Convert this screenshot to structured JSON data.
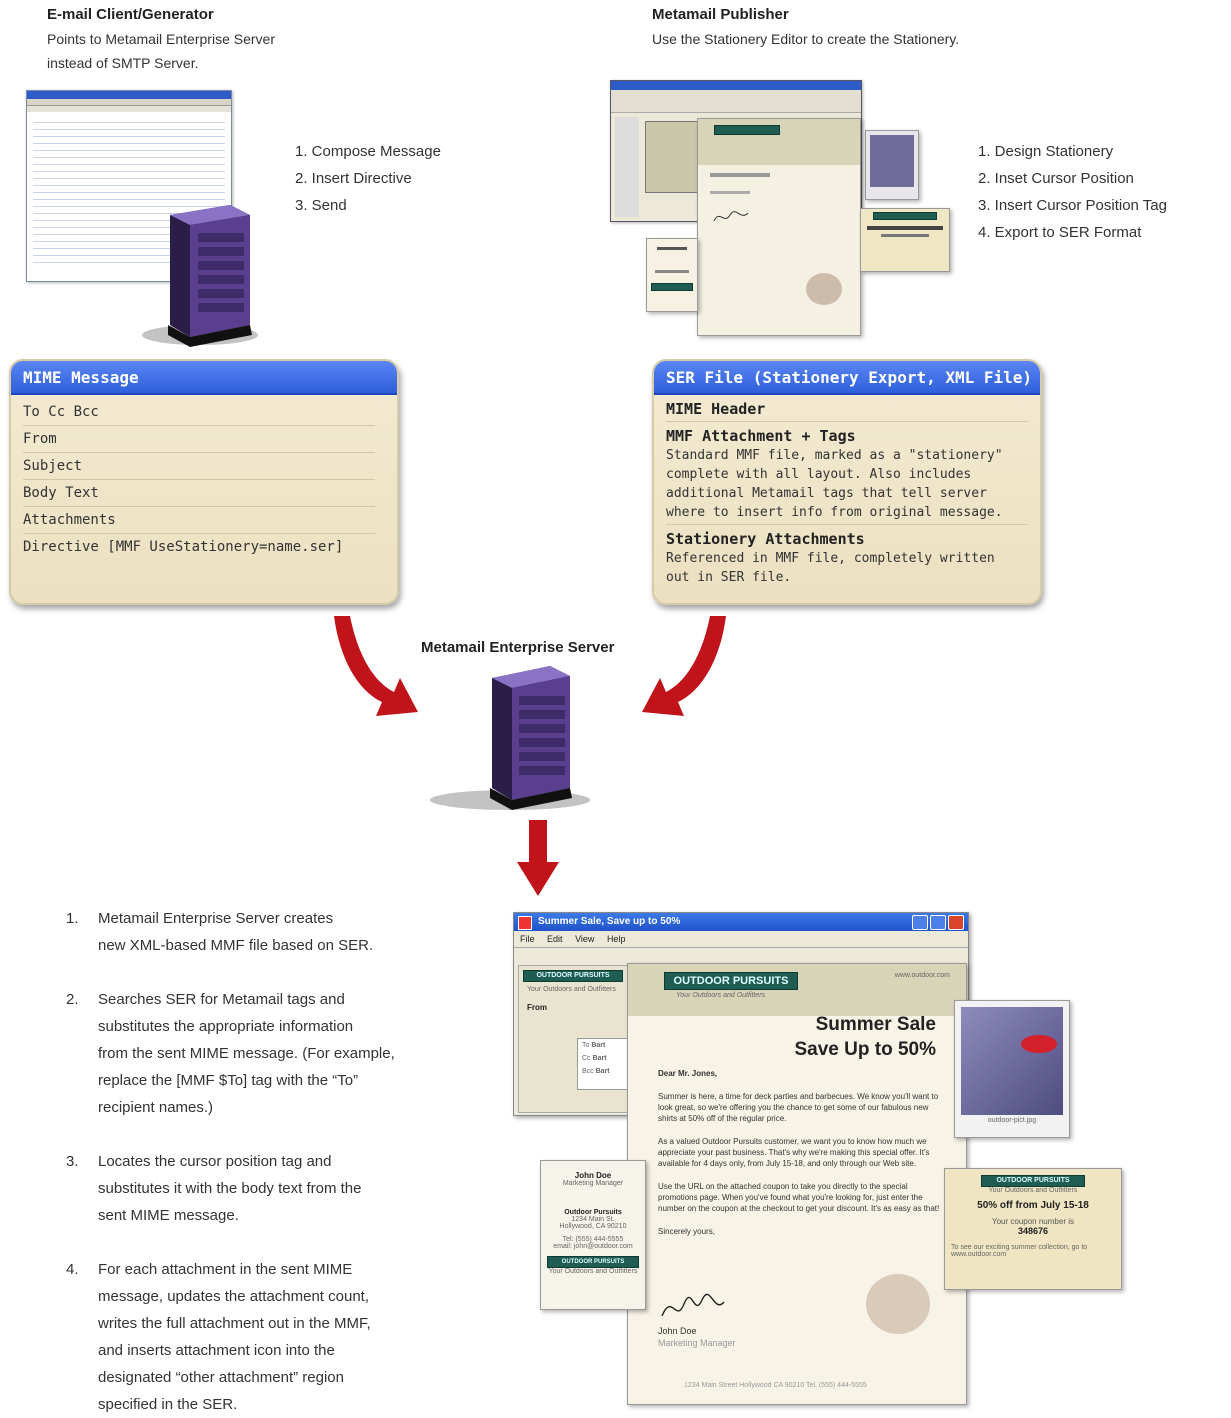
{
  "email_client": {
    "title": "E-mail Client/Generator",
    "subtitle_line1": "Points to Metamail Enterprise Server",
    "subtitle_line2": "instead of SMTP Server.",
    "steps": [
      "1.  Compose Message",
      "2.  Insert Directive",
      "3.  Send"
    ]
  },
  "publisher": {
    "title": "Metamail Publisher",
    "subtitle": "Use the Stationery Editor to create the Stationery.",
    "steps": [
      "1.  Design Stationery",
      "2.  Inset Cursor Position",
      "3.  Insert Cursor Position Tag",
      "4.  Export to SER Format"
    ]
  },
  "mime_panel": {
    "title": "MIME Message",
    "rows": [
      "To Cc Bcc",
      "From",
      "Subject",
      "Body Text",
      "Attachments",
      "Directive [MMF UseStationery=name.ser]"
    ]
  },
  "ser_panel": {
    "title": "SER File (Stationery Export, XML File)",
    "blocks": [
      {
        "heading": "MIME Header",
        "text": ""
      },
      {
        "heading": "MMF Attachment + Tags",
        "lines": [
          "Standard MMF file, marked as a \"stationery\"",
          "complete with all layout. Also includes",
          "additional Metamail tags that tell server",
          "where to insert info from original message."
        ]
      },
      {
        "heading": "Stationery Attachments",
        "lines": [
          "Referenced in MMF file, completely written",
          "out in SER file."
        ]
      }
    ]
  },
  "server": {
    "label": "Metamail Enterprise Server"
  },
  "process_steps": [
    {
      "num": "1.",
      "lines": [
        "Metamail Enterprise Server creates",
        "new XML-based MMF file based on SER."
      ]
    },
    {
      "num": "2.",
      "lines": [
        "Searches SER for Metamail tags and",
        "substitutes the appropriate information",
        "from the sent MIME message. (For example,",
        "replace the [MMF $To] tag with the “To”",
        "recipient names.)"
      ]
    },
    {
      "num": "3.",
      "lines": [
        "Locates the cursor position tag and",
        "substitutes it with the body text from the",
        "sent MIME message."
      ]
    },
    {
      "num": "4.",
      "lines": [
        "For each attachment in the sent MIME",
        "message, updates the attachment count,",
        "writes the full attachment out in the MMF,",
        "and inserts attachment icon into the",
        "designated “other attachment” region",
        "specified in the SER."
      ]
    }
  ],
  "result_window": {
    "title": "Summer Sale, Save up to 50%",
    "menu": [
      "File",
      "Edit",
      "View",
      "Help"
    ],
    "brand": "OUTDOOR PURSUITS",
    "tagline": "Your Outdoors and Outfitters",
    "website": "www.outdoor.com",
    "headline1": "Summer Sale",
    "headline2": "Save Up to 50%",
    "greeting": "Dear Mr. Jones,",
    "body1": "Summer is here, a time for deck parties and barbecues. We know you'll want to look great, so we're offering you the chance to get some of our fabulous new shirts at 50% off of the regular price.",
    "body2": "As a valued Outdoor Pursuits customer, we want you to know how much we appreciate your past business. That's why we're making this special offer. It's available for 4 days only, from July 15-18, and only through our Web site.",
    "body3": "Use the URL on the attached coupon to take you directly to the special promotions page. When you've found what you're looking for, just enter the number on the coupon at the checkout to get your discount. It's as easy as that!",
    "closing": "Sincerely yours,",
    "signer": "John Doe",
    "signer_title": "Marketing Manager",
    "footer": "1234 Main Street    Hollywood CA    90210    Tel. (555) 444-5555",
    "from_label": "From",
    "addr_labels": [
      "To",
      "Cc",
      "Bcc"
    ],
    "addr_values": [
      "Bart",
      "Bart",
      "Bart"
    ],
    "card_name": "John Doe",
    "card_title": "Marketing Manager",
    "card_company": "Outdoor Pursuits",
    "card_addr1": "1234 Main St.",
    "card_addr2": "Hollywood, CA 90210",
    "card_tel": "Tel: (555) 444-5555",
    "card_email": "email: john@outdoor.com",
    "photo_caption": "outdoor-pict.jpg",
    "coupon_headline": "50% off from July 15-18",
    "coupon_number_label": "Your coupon number is",
    "coupon_number": "348676",
    "coupon_note": "To see our exciting summer collection, go to www.outdoor.com"
  },
  "colors": {
    "panel_blue": "#2e5fdc",
    "panel_beige": "#efe5c8",
    "arrow_red": "#c0141a",
    "server_purple": "#5a3f8f"
  }
}
